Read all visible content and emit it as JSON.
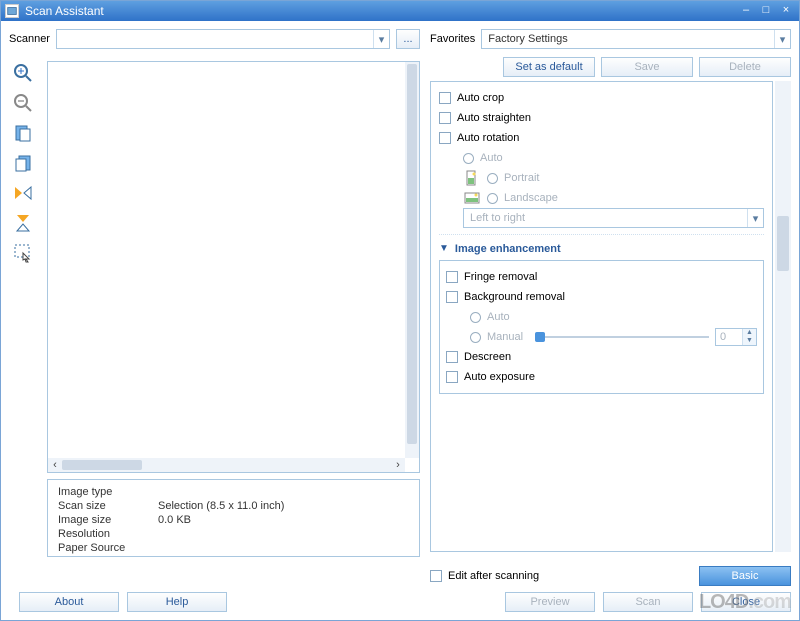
{
  "window": {
    "title": "Scan Assistant"
  },
  "left": {
    "scanner_label": "Scanner",
    "scanner_value": "",
    "browse_label": "..."
  },
  "info": {
    "keys": {
      "image_type": "Image type",
      "scan_size": "Scan size",
      "image_size": "Image size",
      "resolution": "Resolution",
      "paper_source": "Paper Source"
    },
    "values": {
      "image_type": "",
      "scan_size": "Selection (8.5 x 11.0 inch)",
      "image_size": "0.0 KB",
      "resolution": "",
      "paper_source": ""
    }
  },
  "buttons": {
    "about": "About",
    "help": "Help",
    "set_default": "Set as default",
    "save": "Save",
    "delete": "Delete",
    "preview": "Preview",
    "scan": "Scan",
    "close": "Close",
    "basic": "Basic"
  },
  "favorites": {
    "label": "Favorites",
    "value": "Factory Settings"
  },
  "options": {
    "auto_crop": "Auto crop",
    "auto_straighten": "Auto straighten",
    "auto_rotation": "Auto rotation",
    "rotation_auto": "Auto",
    "rotation_portrait": "Portrait",
    "rotation_landscape": "Landscape",
    "rotation_direction": "Left to right",
    "section_enhance": "Image enhancement",
    "fringe_removal": "Fringe removal",
    "background_removal": "Background removal",
    "bg_auto": "Auto",
    "bg_manual": "Manual",
    "bg_manual_value": "0",
    "descreen": "Descreen",
    "auto_exposure": "Auto exposure"
  },
  "edit_after": "Edit after scanning",
  "watermark": {
    "a": "LO4D",
    "b": ".com"
  }
}
